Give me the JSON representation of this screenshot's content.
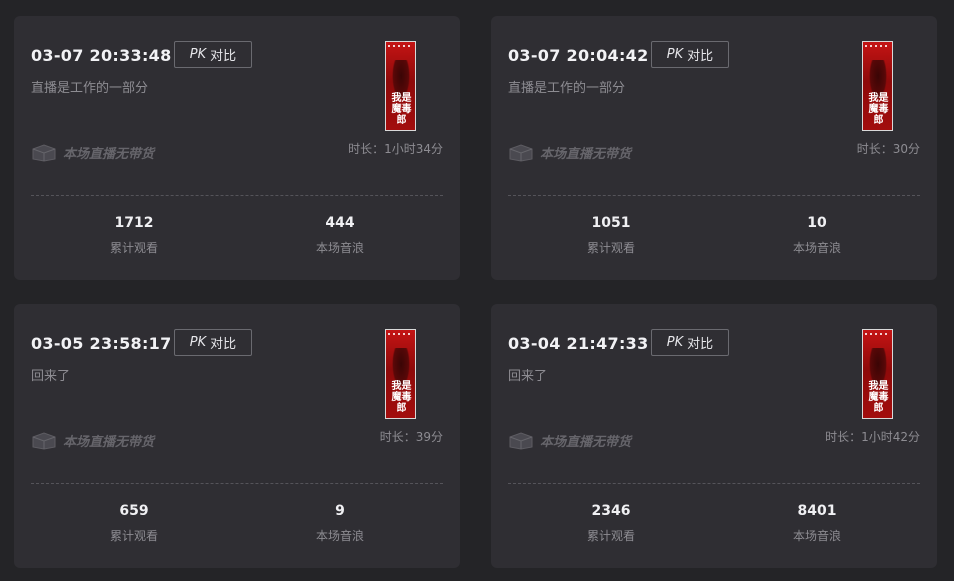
{
  "cards": [
    {
      "time": "03-07 20:33:48",
      "pk_mark": "PK",
      "pk_label": "对比",
      "subtitle": "直播是工作的一部分",
      "poster_text": "我是魔毒郎",
      "nogoods_label": "本场直播无带货",
      "duration": "时长：1小时34分",
      "views": "1712",
      "views_label": "累计观看",
      "waves": "444",
      "waves_label": "本场音浪"
    },
    {
      "time": "03-07 20:04:42",
      "pk_mark": "PK",
      "pk_label": "对比",
      "subtitle": "直播是工作的一部分",
      "poster_text": "我是魔毒郎",
      "nogoods_label": "本场直播无带货",
      "duration": "时长：30分",
      "views": "1051",
      "views_label": "累计观看",
      "waves": "10",
      "waves_label": "本场音浪"
    },
    {
      "time": "03-05 23:58:17",
      "pk_mark": "PK",
      "pk_label": "对比",
      "subtitle": "回来了",
      "poster_text": "我是魔毒郎",
      "nogoods_label": "本场直播无带货",
      "duration": "时长：39分",
      "views": "659",
      "views_label": "累计观看",
      "waves": "9",
      "waves_label": "本场音浪"
    },
    {
      "time": "03-04 21:47:33",
      "pk_mark": "PK",
      "pk_label": "对比",
      "subtitle": "回来了",
      "poster_text": "我是魔毒郎",
      "nogoods_label": "本场直播无带货",
      "duration": "时长：1小时42分",
      "views": "2346",
      "views_label": "累计观看",
      "waves": "8401",
      "waves_label": "本场音浪"
    }
  ],
  "colors": {
    "background": "#242427",
    "card": "#2f2e33",
    "poster_red": "#c41414",
    "muted_text": "#8d8c92"
  }
}
